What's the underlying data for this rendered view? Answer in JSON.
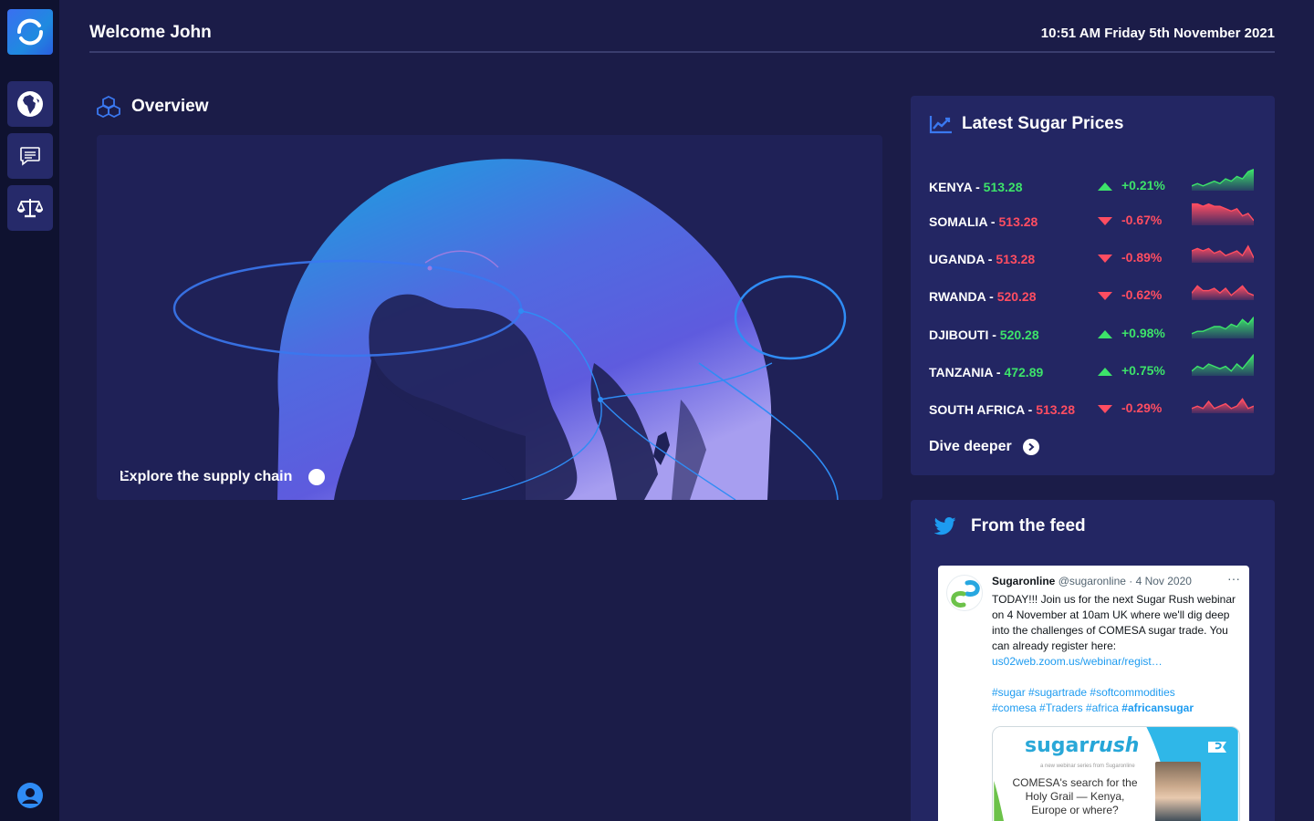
{
  "header": {
    "welcome": "Welcome John",
    "datetime": "10:51 AM Friday 5th November 2021"
  },
  "sidebar": {
    "items": [
      {
        "icon": "globe-africa-icon"
      },
      {
        "icon": "chat-icon"
      },
      {
        "icon": "balance-scale-icon"
      }
    ],
    "user_icon": "user-circle-icon"
  },
  "overview": {
    "title": "Overview",
    "explore_label": "Explore the supply chain"
  },
  "prices": {
    "title": "Latest Sugar Prices",
    "rows": [
      {
        "country": "KENYA",
        "sep": " - ",
        "value": "513.28",
        "change": "+0.21%",
        "trend": "up",
        "spark": [
          2,
          3,
          2,
          3,
          4,
          3,
          5,
          4,
          6,
          5,
          8,
          9
        ]
      },
      {
        "country": "SOMALIA",
        "sep": " - ",
        "value": "513.28",
        "change": "-0.67%",
        "trend": "down",
        "spark": [
          9,
          9,
          8,
          9,
          8,
          8,
          7,
          6,
          7,
          4,
          5,
          2
        ]
      },
      {
        "country": "UGANDA",
        "sep": " - ",
        "value": "513.28",
        "change": "-0.89%",
        "trend": "down",
        "spark": [
          5,
          6,
          5,
          6,
          4,
          5,
          3,
          4,
          5,
          3,
          7,
          2
        ]
      },
      {
        "country": "RWANDA",
        "sep": " - ",
        "value": "520.28",
        "change": "-0.62%",
        "trend": "down",
        "spark": [
          3,
          6,
          4,
          4,
          5,
          3,
          5,
          2,
          4,
          6,
          3,
          2
        ]
      },
      {
        "country": "DJIBOUTI",
        "sep": " - ",
        "value": "520.28",
        "change": "+0.98%",
        "trend": "up",
        "spark": [
          2,
          3,
          3,
          4,
          5,
          5,
          4,
          6,
          5,
          8,
          6,
          9
        ]
      },
      {
        "country": "TANZANIA",
        "sep": " - ",
        "value": "472.89",
        "change": "+0.75%",
        "trend": "up",
        "spark": [
          2,
          4,
          3,
          5,
          4,
          3,
          4,
          2,
          5,
          3,
          6,
          9
        ]
      },
      {
        "country": "SOUTH AFRICA",
        "sep": " - ",
        "value": "513.28",
        "change": "-0.29%",
        "trend": "down",
        "spark": [
          2,
          3,
          2,
          5,
          2,
          3,
          4,
          2,
          3,
          6,
          2,
          3
        ]
      }
    ],
    "dive_label": "Dive deeper"
  },
  "feed": {
    "title": "From the feed",
    "tweet": {
      "name": "Sugaronline",
      "handle": "@sugaronline · 4 Nov 2020",
      "more": "···",
      "text": "TODAY!!! Join us for the next Sugar Rush webinar on 4 November at 10am UK where we'll dig deep into the challenges of COMESA sugar trade. You can already register here:",
      "link": "us02web.zoom.us/webinar/regist…",
      "tags_line1": "#sugar #sugartrade #softcommodities",
      "tags_line2": "#comesa #Traders #africa ",
      "tags_bold": "#africansugar",
      "media": {
        "logo_a": "sugar",
        "logo_b": "rush",
        "sub": "a new webinar series from Sugaronline",
        "text": "COMESA's search for the Holy Grail — Kenya, Europe or where?"
      }
    }
  },
  "colors": {
    "background": "#1b1c48",
    "sidebar": "#0f1230",
    "card": "#232663",
    "up": "#3de36a",
    "down": "#ff4d61",
    "accent": "#3a6ff0"
  }
}
